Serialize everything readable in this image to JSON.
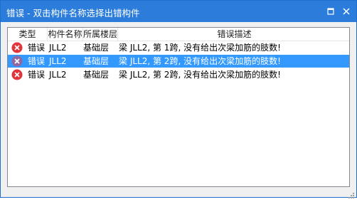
{
  "window": {
    "title": "错误 - 双击构件名称选择出错构件"
  },
  "table": {
    "columns": [
      "类型",
      "构件名称",
      "所属楼层",
      "错误描述"
    ],
    "rows": [
      {
        "type": "错误",
        "name": "JLL2",
        "floor": "基础层",
        "desc": "梁 JLL2, 第 1跨, 没有给出次梁加筋的肢数!",
        "selected": false
      },
      {
        "type": "错误",
        "name": "JLL2",
        "floor": "基础层",
        "desc": "梁 JLL2, 第 2跨, 没有给出次梁加筋的肢数!",
        "selected": true
      },
      {
        "type": "错误",
        "name": "JLL2",
        "floor": "基础层",
        "desc": "梁 JLL2, 第 2跨, 没有给出次梁加筋的肢数!",
        "selected": false
      }
    ]
  },
  "icons": {
    "row_icon": "error-icon",
    "maximize": "maximize-icon",
    "close": "close-icon"
  },
  "colors": {
    "titlebar": "#2c7ddb",
    "selection": "#3399ff",
    "error_icon": "#e0353a"
  }
}
